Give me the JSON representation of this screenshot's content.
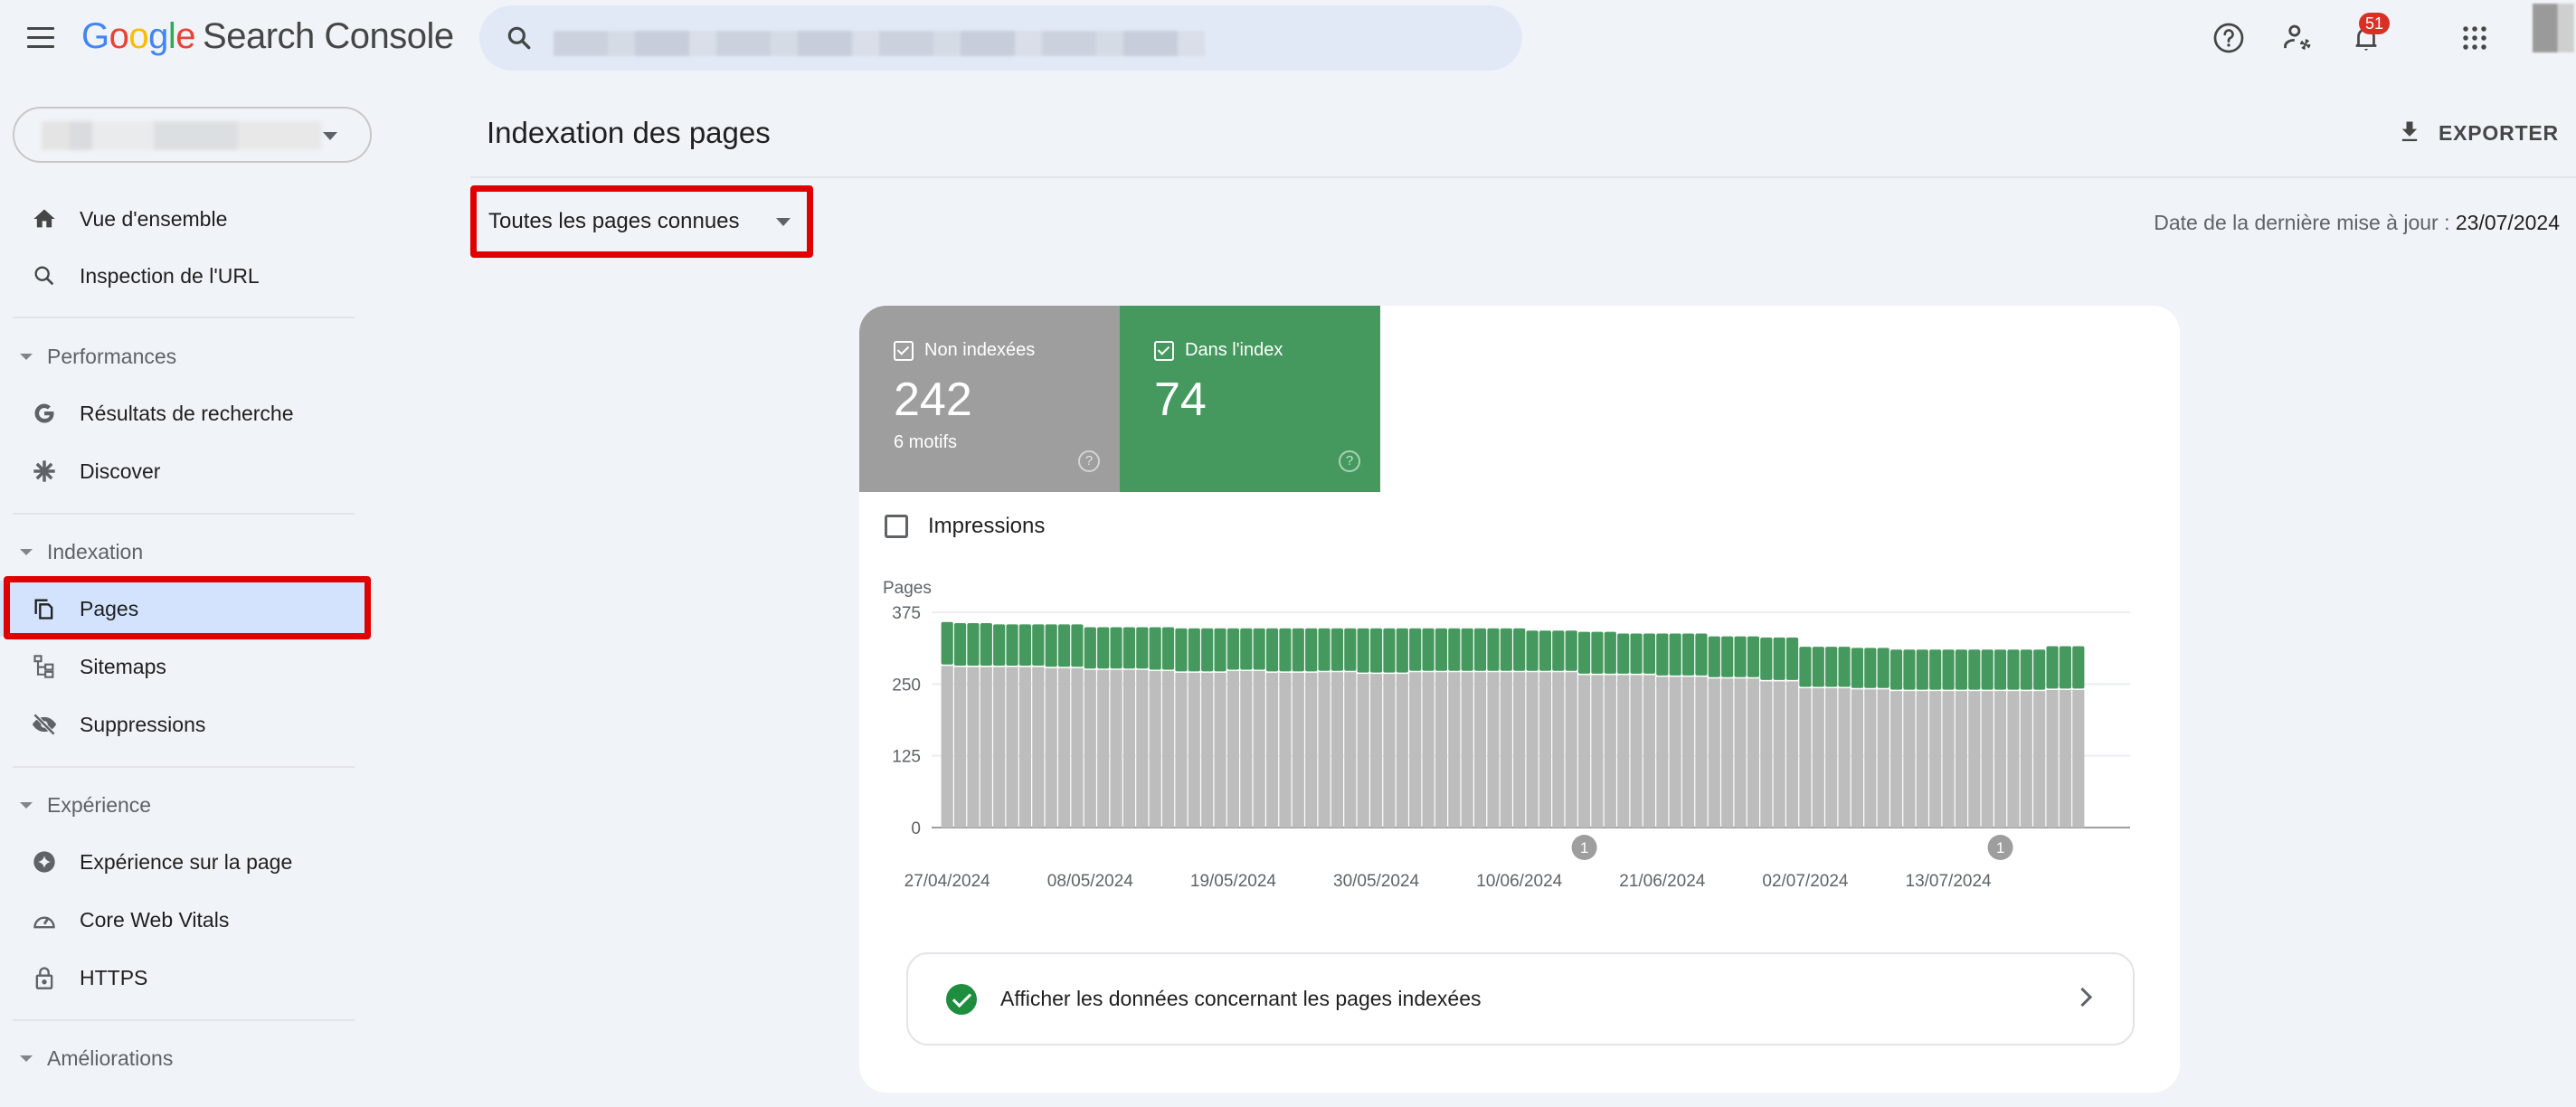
{
  "header": {
    "logo_letters": [
      "G",
      "o",
      "o",
      "g",
      "l",
      "e"
    ],
    "product_name": "Search Console",
    "search": {
      "value_redacted": true,
      "icon": "search-icon"
    },
    "icons": [
      "help-icon",
      "manage-users-icon",
      "notifications-icon",
      "apps-icon"
    ],
    "notifications_count": "51"
  },
  "sidebar": {
    "property_selector": {
      "value_redacted": true
    },
    "top_items": [
      {
        "label": "Vue d'ensemble",
        "icon": "home-icon"
      },
      {
        "label": "Inspection de l'URL",
        "icon": "search-icon"
      }
    ],
    "sections": [
      {
        "title": "Performances",
        "items": [
          {
            "label": "Résultats de recherche",
            "icon": "google-g-icon"
          },
          {
            "label": "Discover",
            "icon": "asterisk-icon"
          }
        ]
      },
      {
        "title": "Indexation",
        "items": [
          {
            "label": "Pages",
            "icon": "pages-icon",
            "active": true
          },
          {
            "label": "Sitemaps",
            "icon": "sitemap-icon"
          },
          {
            "label": "Suppressions",
            "icon": "visibility-off-icon"
          }
        ]
      },
      {
        "title": "Expérience",
        "items": [
          {
            "label": "Expérience sur la page",
            "icon": "sparkle-circle-icon"
          },
          {
            "label": "Core Web Vitals",
            "icon": "speed-gauge-icon"
          },
          {
            "label": "HTTPS",
            "icon": "lock-icon"
          }
        ]
      },
      {
        "title": "Améliorations",
        "items": []
      }
    ]
  },
  "main": {
    "title": "Indexation des pages",
    "export_label": "EXPORTER",
    "filter_value": "Toutes les pages connues",
    "last_update_label": "Date de la dernière mise à jour :",
    "last_update_value": "23/07/2024",
    "tiles": [
      {
        "label": "Non indexées",
        "value": "242",
        "sub": "6 motifs",
        "color": "#9e9e9e"
      },
      {
        "label": "Dans l'index",
        "value": "74",
        "sub": "",
        "color": "#45995e"
      }
    ],
    "impressions_label": "Impressions",
    "indexed_link_label": "Afficher les données concernant les pages indexées"
  },
  "chart_data": {
    "type": "bar",
    "stacked": true,
    "ylabel": "Pages",
    "ylim": [
      0,
      375
    ],
    "yticks": [
      0,
      125,
      250,
      375
    ],
    "grid": true,
    "x_start": "27/04/2024",
    "x_end": "23/07/2024",
    "xtick_labels": [
      "27/04/2024",
      "08/05/2024",
      "19/05/2024",
      "30/05/2024",
      "10/06/2024",
      "21/06/2024",
      "02/07/2024",
      "13/07/2024"
    ],
    "xtick_every_days": 11,
    "annotations": [
      {
        "label": "1",
        "date_index": 49
      },
      {
        "label": "1",
        "date_index": 81
      }
    ],
    "series": [
      {
        "name": "Non indexées",
        "color": "#bdbdbd",
        "values": [
          284,
          282,
          282,
          282,
          282,
          282,
          282,
          282,
          280,
          280,
          280,
          277,
          277,
          277,
          277,
          277,
          275,
          275,
          272,
          272,
          272,
          272,
          275,
          275,
          275,
          272,
          272,
          272,
          272,
          273,
          273,
          273,
          270,
          270,
          270,
          270,
          273,
          273,
          273,
          273,
          273,
          273,
          273,
          273,
          273,
          273,
          273,
          273,
          273,
          268,
          268,
          268,
          268,
          268,
          268,
          265,
          265,
          265,
          265,
          262,
          262,
          262,
          262,
          257,
          257,
          257,
          245,
          245,
          245,
          245,
          243,
          243,
          243,
          240,
          240,
          240,
          240,
          240,
          240,
          240,
          240,
          240,
          240,
          240,
          240,
          242,
          242,
          242
        ]
      },
      {
        "name": "Dans l'index",
        "color": "#45995e",
        "values": [
          74,
          74,
          74,
          74,
          72,
          72,
          72,
          72,
          74,
          74,
          74,
          72,
          72,
          72,
          72,
          72,
          74,
          74,
          75,
          75,
          75,
          75,
          72,
          72,
          72,
          75,
          75,
          75,
          75,
          74,
          74,
          74,
          77,
          77,
          77,
          77,
          74,
          74,
          74,
          74,
          74,
          74,
          74,
          74,
          74,
          70,
          70,
          70,
          70,
          73,
          73,
          73,
          70,
          70,
          70,
          73,
          73,
          73,
          73,
          71,
          71,
          71,
          71,
          74,
          74,
          74,
          70,
          70,
          70,
          70,
          70,
          70,
          70,
          70,
          70,
          70,
          70,
          70,
          70,
          70,
          70,
          70,
          70,
          70,
          70,
          74,
          74,
          74
        ]
      }
    ]
  }
}
